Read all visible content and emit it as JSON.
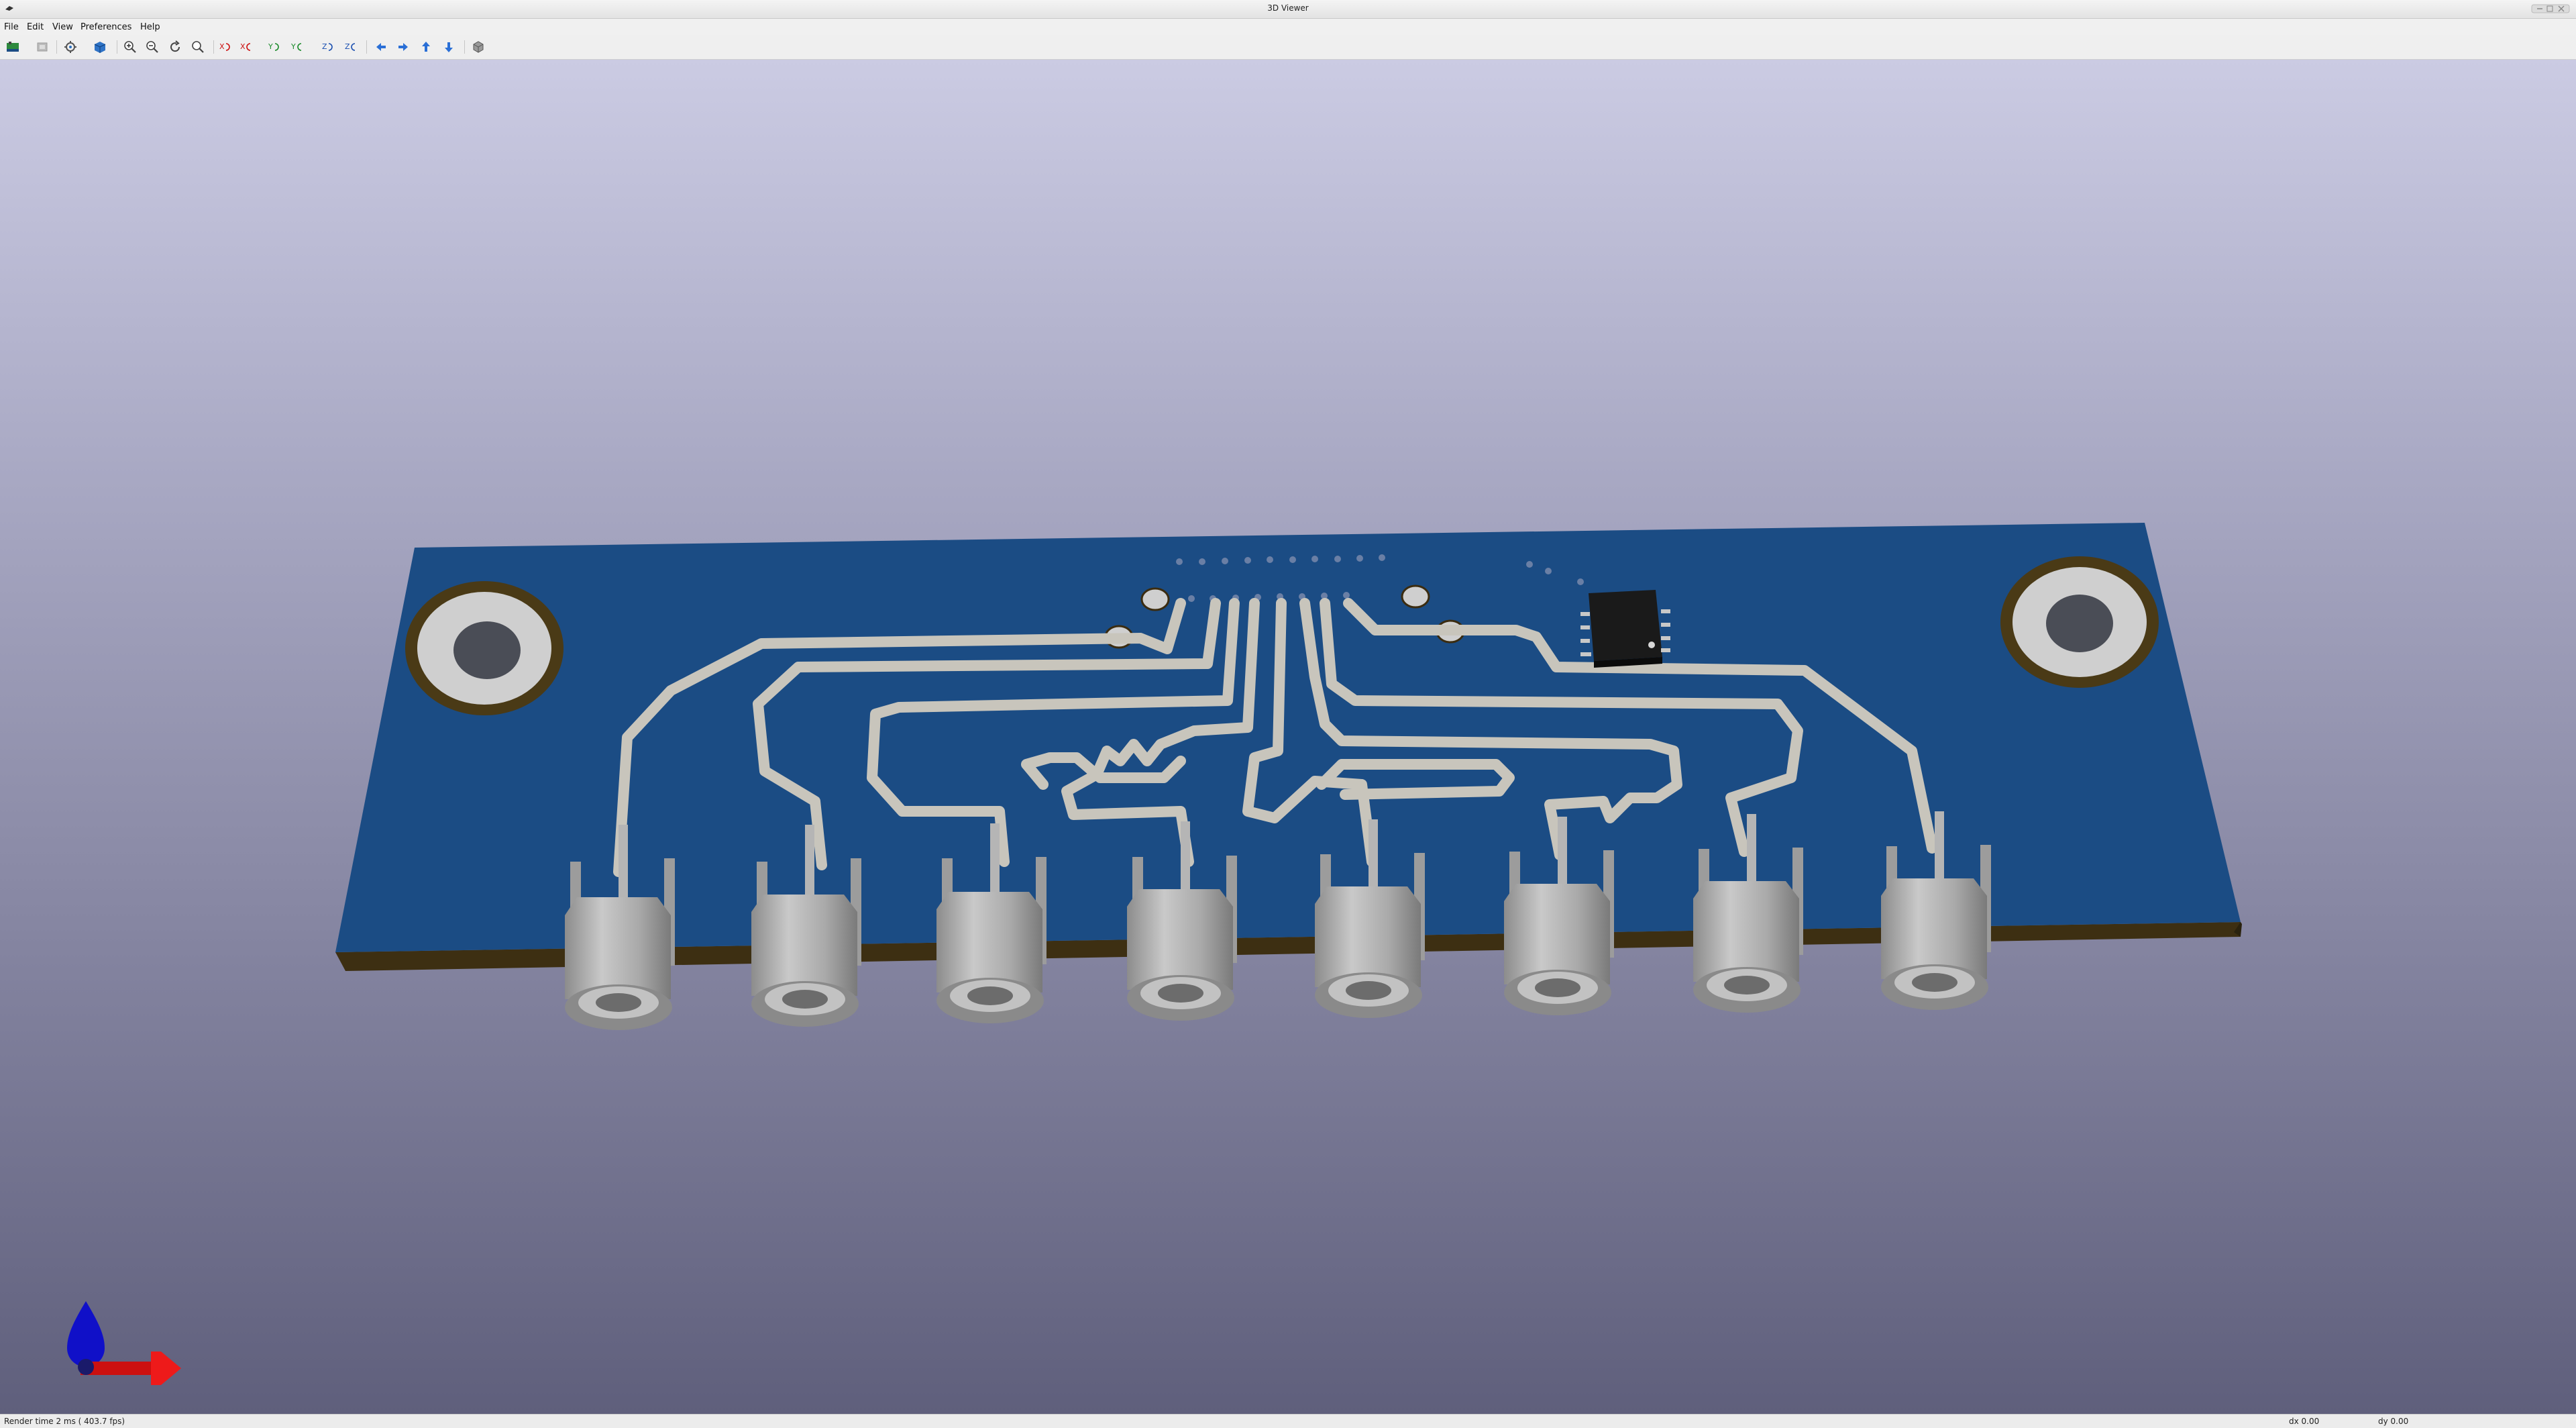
{
  "window": {
    "title": "3D Viewer"
  },
  "menu": [
    "File",
    "Edit",
    "View",
    "Preferences",
    "Help"
  ],
  "toolbar": {
    "buttons": [
      "render-options-icon",
      "copy-image-icon",
      "refresh-icon",
      "board-3d-icon",
      "zoom-in-icon",
      "zoom-out-icon",
      "rotate-reset-icon",
      "zoom-fit-icon",
      "rotate-x-cw-icon",
      "rotate-x-ccw-icon",
      "rotate-y-cw-icon",
      "rotate-y-ccw-icon",
      "rotate-z-cw-icon",
      "rotate-z-ccw-icon",
      "pan-left-icon",
      "pan-right-icon",
      "pan-up-icon",
      "pan-down-icon",
      "orthographic-icon"
    ]
  },
  "status": {
    "render_time": "Render time 2 ms ( 403.7 fps)",
    "dx": "dx 0.00",
    "dy": "dy 0.00"
  },
  "scene": {
    "board_color": "#1b4c84",
    "trace_color": "#c8c5bc",
    "connector_count": 8
  }
}
